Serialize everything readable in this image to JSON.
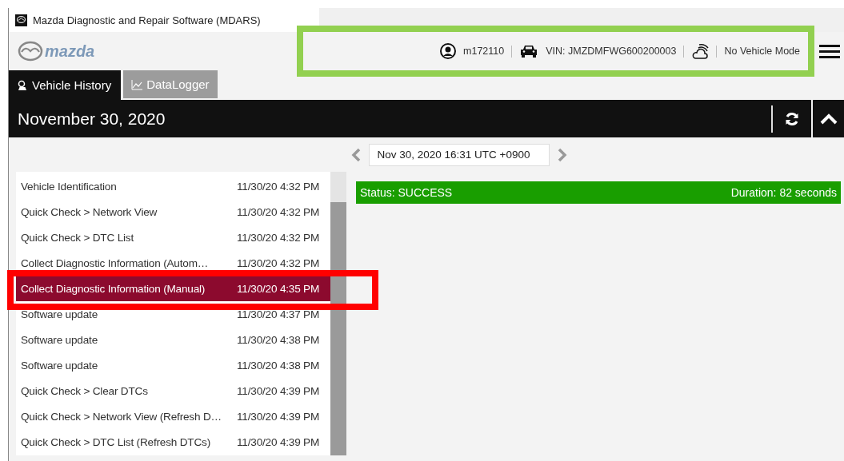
{
  "window": {
    "title": "Mazda Diagnostic and Repair Software (MDARS)"
  },
  "header": {
    "brand": "mazda",
    "user": "m172110",
    "vin": "VIN: JMZDMFWG600200003",
    "mode": "No Vehicle Mode"
  },
  "tabs": [
    {
      "label": "Vehicle History",
      "kind": "history",
      "selected": true
    },
    {
      "label": "DataLogger",
      "kind": "chart",
      "selected": false
    }
  ],
  "date_title": "November 30, 2020",
  "date_field": {
    "value": "Nov 30, 2020 16:31 UTC +0900"
  },
  "records": [
    {
      "name": "Vehicle Identification",
      "time": "11/30/20 4:32 PM",
      "selected": false
    },
    {
      "name": "Quick Check > Network View",
      "time": "11/30/20 4:32 PM",
      "selected": false
    },
    {
      "name": "Quick Check > DTC List",
      "time": "11/30/20 4:32 PM",
      "selected": false
    },
    {
      "name": "Collect Diagnostic Information (Autom…",
      "time": "11/30/20 4:32 PM",
      "selected": false
    },
    {
      "name": "Collect Diagnostic Information (Manual)",
      "time": "11/30/20 4:35 PM",
      "selected": true
    },
    {
      "name": "Software update",
      "time": "11/30/20 4:37 PM",
      "selected": false
    },
    {
      "name": "Software update",
      "time": "11/30/20 4:38 PM",
      "selected": false
    },
    {
      "name": "Software update",
      "time": "11/30/20 4:38 PM",
      "selected": false
    },
    {
      "name": "Quick Check > Clear DTCs",
      "time": "11/30/20 4:39 PM",
      "selected": false
    },
    {
      "name": "Quick Check > Network View (Refresh D…",
      "time": "11/30/20 4:39 PM",
      "selected": false
    },
    {
      "name": "Quick Check > DTC List (Refresh DTCs)",
      "time": "11/30/20 4:39 PM",
      "selected": false
    }
  ],
  "status": {
    "text": "Status: SUCCESS",
    "duration": "Duration: 82 seconds"
  },
  "header_highlight": {
    "color": "#92d050"
  },
  "record_highlight": {
    "color": "#ff0000"
  }
}
